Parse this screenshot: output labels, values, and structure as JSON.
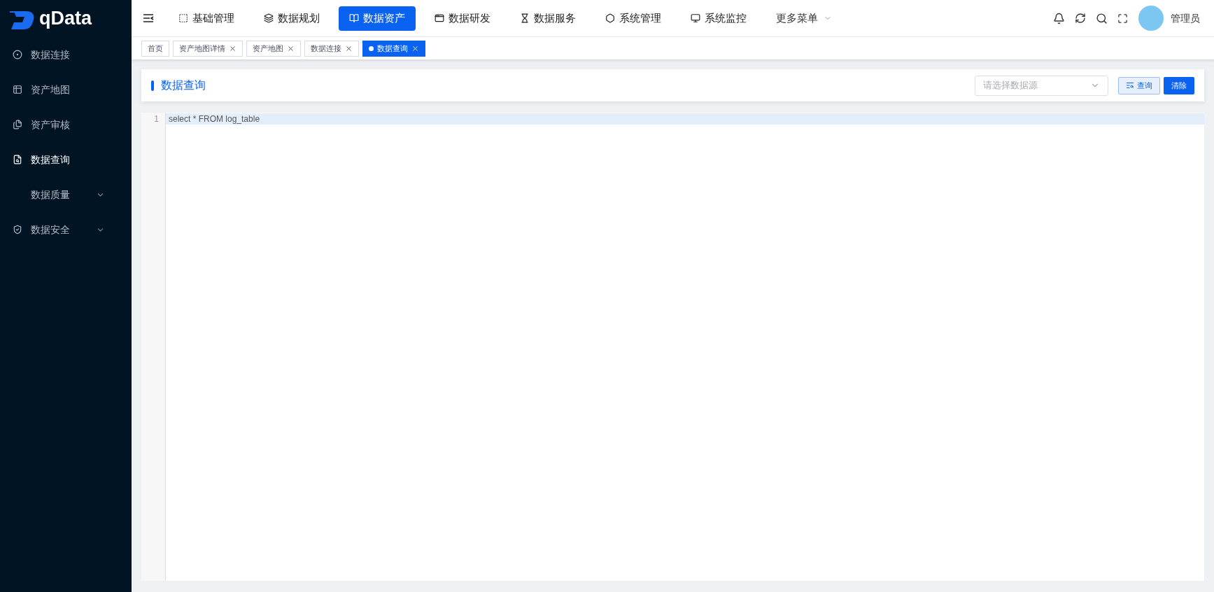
{
  "logo": {
    "text": "qData"
  },
  "nav": {
    "items": [
      {
        "label": "基础管理",
        "selected": false
      },
      {
        "label": "数据规划",
        "selected": false
      },
      {
        "label": "数据资产",
        "selected": true
      },
      {
        "label": "数据研发",
        "selected": false
      },
      {
        "label": "数据服务",
        "selected": false
      },
      {
        "label": "系统管理",
        "selected": false
      },
      {
        "label": "系统监控",
        "selected": false
      }
    ],
    "more": {
      "label": "更多菜单"
    }
  },
  "user": {
    "name": "管理员"
  },
  "sidebar": {
    "items": [
      {
        "label": "数据连接",
        "selected": false,
        "expandable": false
      },
      {
        "label": "资产地图",
        "selected": false,
        "expandable": false
      },
      {
        "label": "资产审核",
        "selected": false,
        "expandable": false
      },
      {
        "label": "数据查询",
        "selected": true,
        "expandable": false
      },
      {
        "label": "数据质量",
        "selected": false,
        "expandable": true
      },
      {
        "label": "数据安全",
        "selected": false,
        "expandable": true
      }
    ]
  },
  "tabs": [
    {
      "label": "首页",
      "selected": false,
      "closable": false
    },
    {
      "label": "资产地图详情",
      "selected": false,
      "closable": true
    },
    {
      "label": "资产地图",
      "selected": false,
      "closable": true
    },
    {
      "label": "数据连接",
      "selected": false,
      "closable": true
    },
    {
      "label": "数据查询",
      "selected": true,
      "closable": true
    }
  ],
  "page": {
    "title": "数据查询",
    "datasource": {
      "placeholder": "请选择数据源"
    },
    "query_button": "查询",
    "clear_button": "清除"
  },
  "editor": {
    "lines": [
      {
        "number": "1",
        "text": "select * FROM log_table",
        "selected": true
      }
    ]
  }
}
